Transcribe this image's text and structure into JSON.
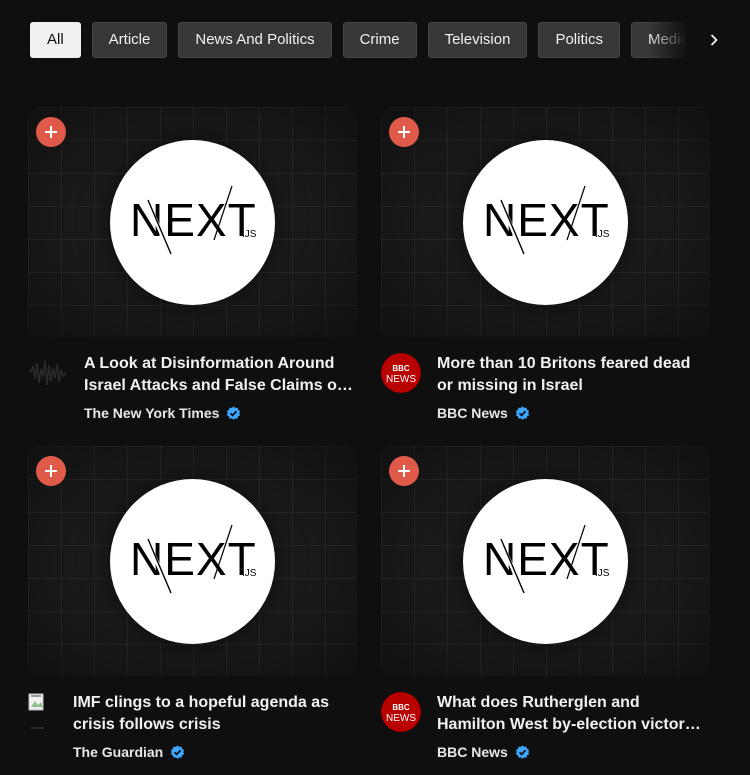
{
  "chips": [
    {
      "label": "All",
      "active": true
    },
    {
      "label": "Article",
      "active": false
    },
    {
      "label": "News And Politics",
      "active": false
    },
    {
      "label": "Crime",
      "active": false
    },
    {
      "label": "Television",
      "active": false
    },
    {
      "label": "Politics",
      "active": false
    },
    {
      "label": "Medica",
      "active": false
    }
  ],
  "icons": {
    "next": "chevron-right-icon",
    "add": "plus-icon",
    "verified": "verified-check-icon"
  },
  "colors": {
    "add_button": "#e05a4a",
    "verified": "#3ea6ff",
    "bbc_red": "#b80000"
  },
  "thumbnail_logo": {
    "wordmark": "NEXT",
    "suffix": ".JS"
  },
  "cards": [
    {
      "title": "A Look at Disinformation Around Israel Attacks and False Claims on Social Media",
      "channel": "The New York Times",
      "verified": true,
      "avatar": "nyt-waveform-avatar"
    },
    {
      "title": "More than 10 Britons feared dead or missing in Israel",
      "channel": "BBC News",
      "verified": true,
      "avatar": "bbc-news-avatar",
      "avatar_text": {
        "top": "BBC",
        "bottom": "NEWS"
      }
    },
    {
      "title": "IMF clings to a hopeful agenda as crisis follows crisis",
      "channel": "The Guardian",
      "verified": true,
      "avatar": "broken-image-avatar"
    },
    {
      "title": "What does Rutherglen and Hamilton West by-election victory mean for Labour?",
      "channel": "BBC News",
      "verified": true,
      "avatar": "bbc-news-avatar",
      "avatar_text": {
        "top": "BBC",
        "bottom": "NEWS"
      }
    }
  ]
}
